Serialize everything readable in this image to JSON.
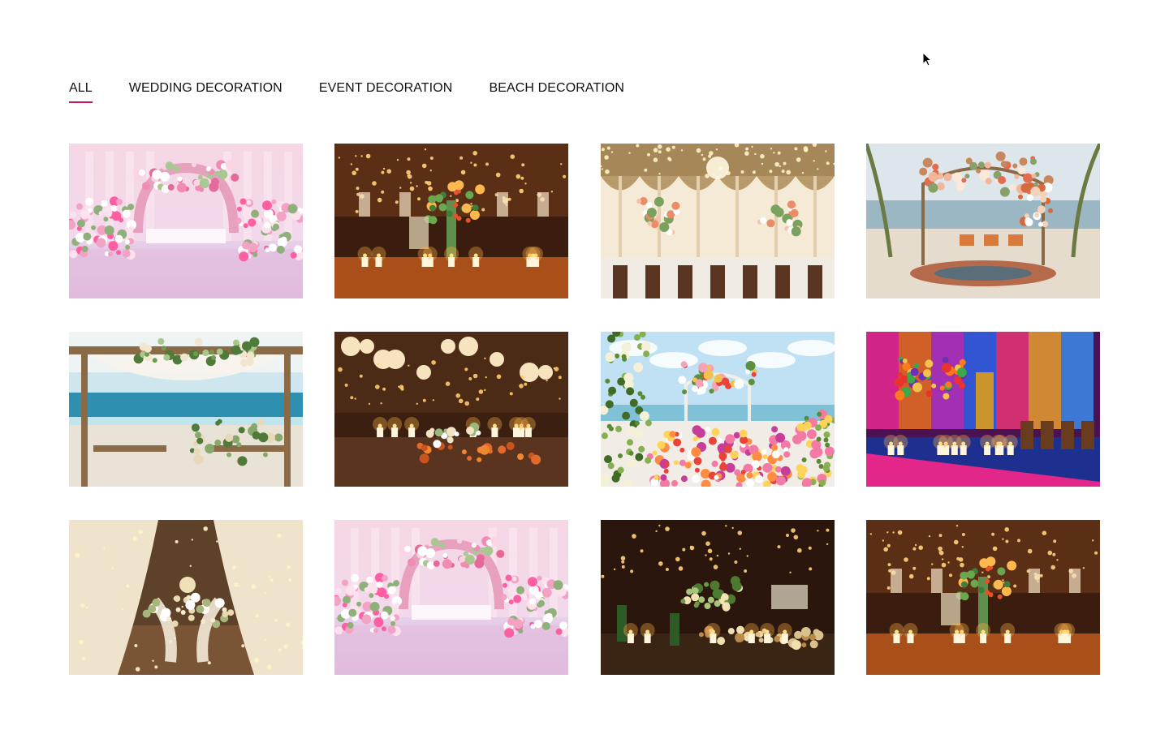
{
  "filters": {
    "tabs": [
      {
        "label": "ALL",
        "active": true
      },
      {
        "label": "WEDDING DECORATION",
        "active": false
      },
      {
        "label": "EVENT DECORATION",
        "active": false
      },
      {
        "label": "BEACH DECORATION",
        "active": false
      }
    ],
    "active_color": "#c2185b"
  },
  "gallery": {
    "items": [
      {
        "theme": "pink-floral-stage"
      },
      {
        "theme": "barn-candle-lights"
      },
      {
        "theme": "white-drape-chandelier-hall"
      },
      {
        "theme": "beach-boho-arch"
      },
      {
        "theme": "beach-pergola-tables"
      },
      {
        "theme": "barn-lanterns-dinner"
      },
      {
        "theme": "beach-floral-arch-petals"
      },
      {
        "theme": "vibrant-neon-banquet"
      },
      {
        "theme": "fairy-light-drapes-ballroom"
      },
      {
        "theme": "pink-floral-stage"
      },
      {
        "theme": "rustic-candle-table"
      },
      {
        "theme": "barn-candle-lights"
      }
    ]
  }
}
